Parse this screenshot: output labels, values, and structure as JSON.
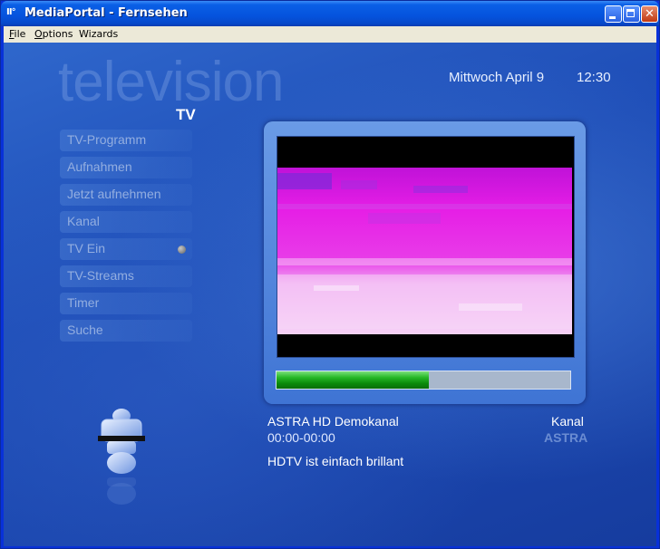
{
  "window": {
    "title": "MediaPortal - Fernsehen",
    "app_icon_glyph": "Ⅱ°"
  },
  "menubar": {
    "items": [
      {
        "label_ul": "F",
        "label_rest": "ile"
      },
      {
        "label_ul": "O",
        "label_rest": "ptions"
      },
      {
        "label_ul": "",
        "label_rest": "Wizards"
      }
    ]
  },
  "header": {
    "background_word": "television",
    "section_title": "TV",
    "date": "Mittwoch April 9",
    "time": "12:30"
  },
  "sidebar": {
    "items": [
      {
        "label": "TV-Programm"
      },
      {
        "label": "Aufnahmen"
      },
      {
        "label": "Jetzt aufnehmen"
      },
      {
        "label": "Kanal"
      },
      {
        "label": "TV Ein",
        "status_indicator": "gray-dot"
      },
      {
        "label": "TV-Streams"
      },
      {
        "label": "Timer"
      },
      {
        "label": "Suche"
      }
    ]
  },
  "preview": {
    "progress_fraction": 0.52,
    "progress_color": "#0b8a0b"
  },
  "channel": {
    "name": "ASTRA HD Demokanal",
    "label": "Kanal",
    "time_range": "00:00-00:00",
    "logo_text": "ASTRA",
    "description": "HDTV ist einfach brillant"
  },
  "colors": {
    "background": "#1d4cb6",
    "menu_text": "#93aee0",
    "video_magenta": "#e020e8"
  }
}
